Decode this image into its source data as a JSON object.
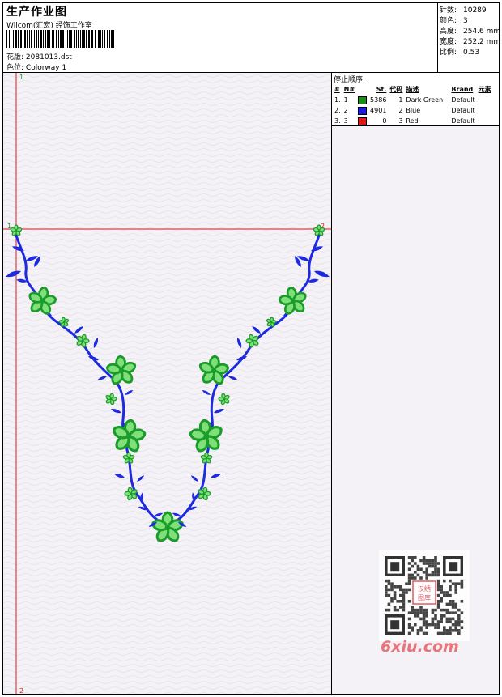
{
  "header": {
    "title": "生产作业图",
    "company": "Wilcom(汇宏) 经饰工作室",
    "design_label": "花版:",
    "design_value": "2081013.dst",
    "colorway_label": "色位:",
    "colorway_value": "Colorway 1"
  },
  "stats": [
    {
      "label": "针数:",
      "value": "10289"
    },
    {
      "label": "颜色:",
      "value": "3"
    },
    {
      "label": "高度:",
      "value": "254.6 mm"
    },
    {
      "label": "宽度:",
      "value": "252.2 mm"
    },
    {
      "label": "比例:",
      "value": "0.53"
    }
  ],
  "stop_sequence": {
    "title": "停止顺序:",
    "headers": {
      "num": "#",
      "n": "N#",
      "st": "St.",
      "code": "代码",
      "desc": "描述",
      "brand": "Brand",
      "elem": "元素"
    },
    "rows": [
      {
        "num": "1.",
        "n": "1",
        "color": "#1a8f1a",
        "st": "5386",
        "code": "1",
        "desc": "Dark Green",
        "brand": "Default"
      },
      {
        "num": "2.",
        "n": "2",
        "color": "#1a1adf",
        "st": "4901",
        "code": "2",
        "desc": "Blue",
        "brand": "Default"
      },
      {
        "num": "3.",
        "n": "3",
        "color": "#e01818",
        "st": "0",
        "code": "3",
        "desc": "Red",
        "brand": "Default"
      }
    ]
  },
  "markers": {
    "top": "1",
    "bottom": "2",
    "left": "1",
    "right": "2"
  },
  "watermark": {
    "seal": "汉绣图库",
    "site": "6xiu.com"
  },
  "colors": {
    "stem": "#1e2adf",
    "leaf_green": "#1a9b2a",
    "leaf_light": "#7fe07a",
    "guide_red": "#e01818",
    "canvas_bg": "#f4f2f6"
  }
}
